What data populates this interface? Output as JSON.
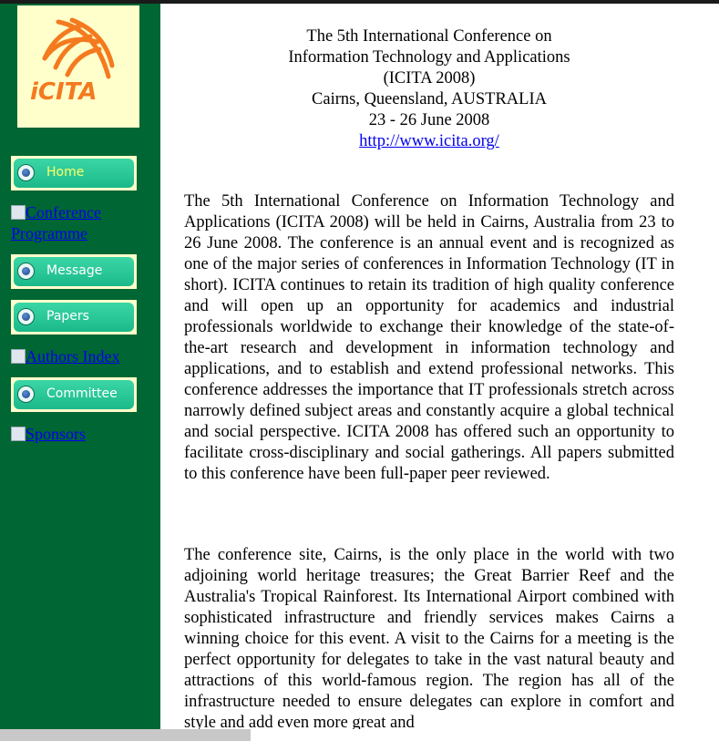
{
  "logo": {
    "text": "iCITA",
    "brand_color": "#f47a1f",
    "background": "#ffffcc"
  },
  "sidebar": {
    "background": "#006633",
    "buttons": [
      {
        "label": "Home",
        "active": true
      },
      {
        "label": "Message"
      },
      {
        "label": "Papers"
      },
      {
        "label": "Committee"
      }
    ],
    "links": [
      {
        "label": "Conference Programme"
      },
      {
        "label": "Authors Index"
      },
      {
        "label": "Sponsors"
      }
    ]
  },
  "header": {
    "line1": "The 5th International Conference on",
    "line2": "Information Technology and Applications",
    "line3": "(ICITA 2008)",
    "line4": "Cairns, Queensland, AUSTRALIA",
    "line5": "23 - 26 June 2008",
    "url": "http://www.icita.org/"
  },
  "body": {
    "paragraph1": "The 5th International Conference on Information Technology and Applications (ICITA 2008) will be held in Cairns, Australia from 23 to 26 June 2008. The conference is an annual event and is recognized as one of the major series of conferences in Information Technology (IT in short). ICITA continues to retain its tradition of high quality conference and will open up an opportunity for academics and industrial professionals worldwide to exchange their knowledge of the state-of-the-art research and development in information technology and applications, and to establish and extend professional networks. This conference addresses the importance that IT professionals stretch across narrowly defined subject areas and constantly acquire a global technical and social perspective. ICITA 2008 has offered such an opportunity to facilitate cross-disciplinary and social gatherings. All papers submitted to this conference have been full-paper peer reviewed.",
    "paragraph2": "The conference site, Cairns, is the only place in the world with two adjoining world heritage treasures; the Great Barrier Reef and the Australia's Tropical Rainforest. Its International Airport combined with sophisticated infrastructure and friendly services makes Cairns a winning choice for this event. A visit to the Cairns for a meeting is the perfect opportunity for delegates to take in the vast natural beauty and attractions of this world-famous region. The region has all of the infrastructure needed to ensure delegates can explore in comfort and style and add even more great and"
  }
}
